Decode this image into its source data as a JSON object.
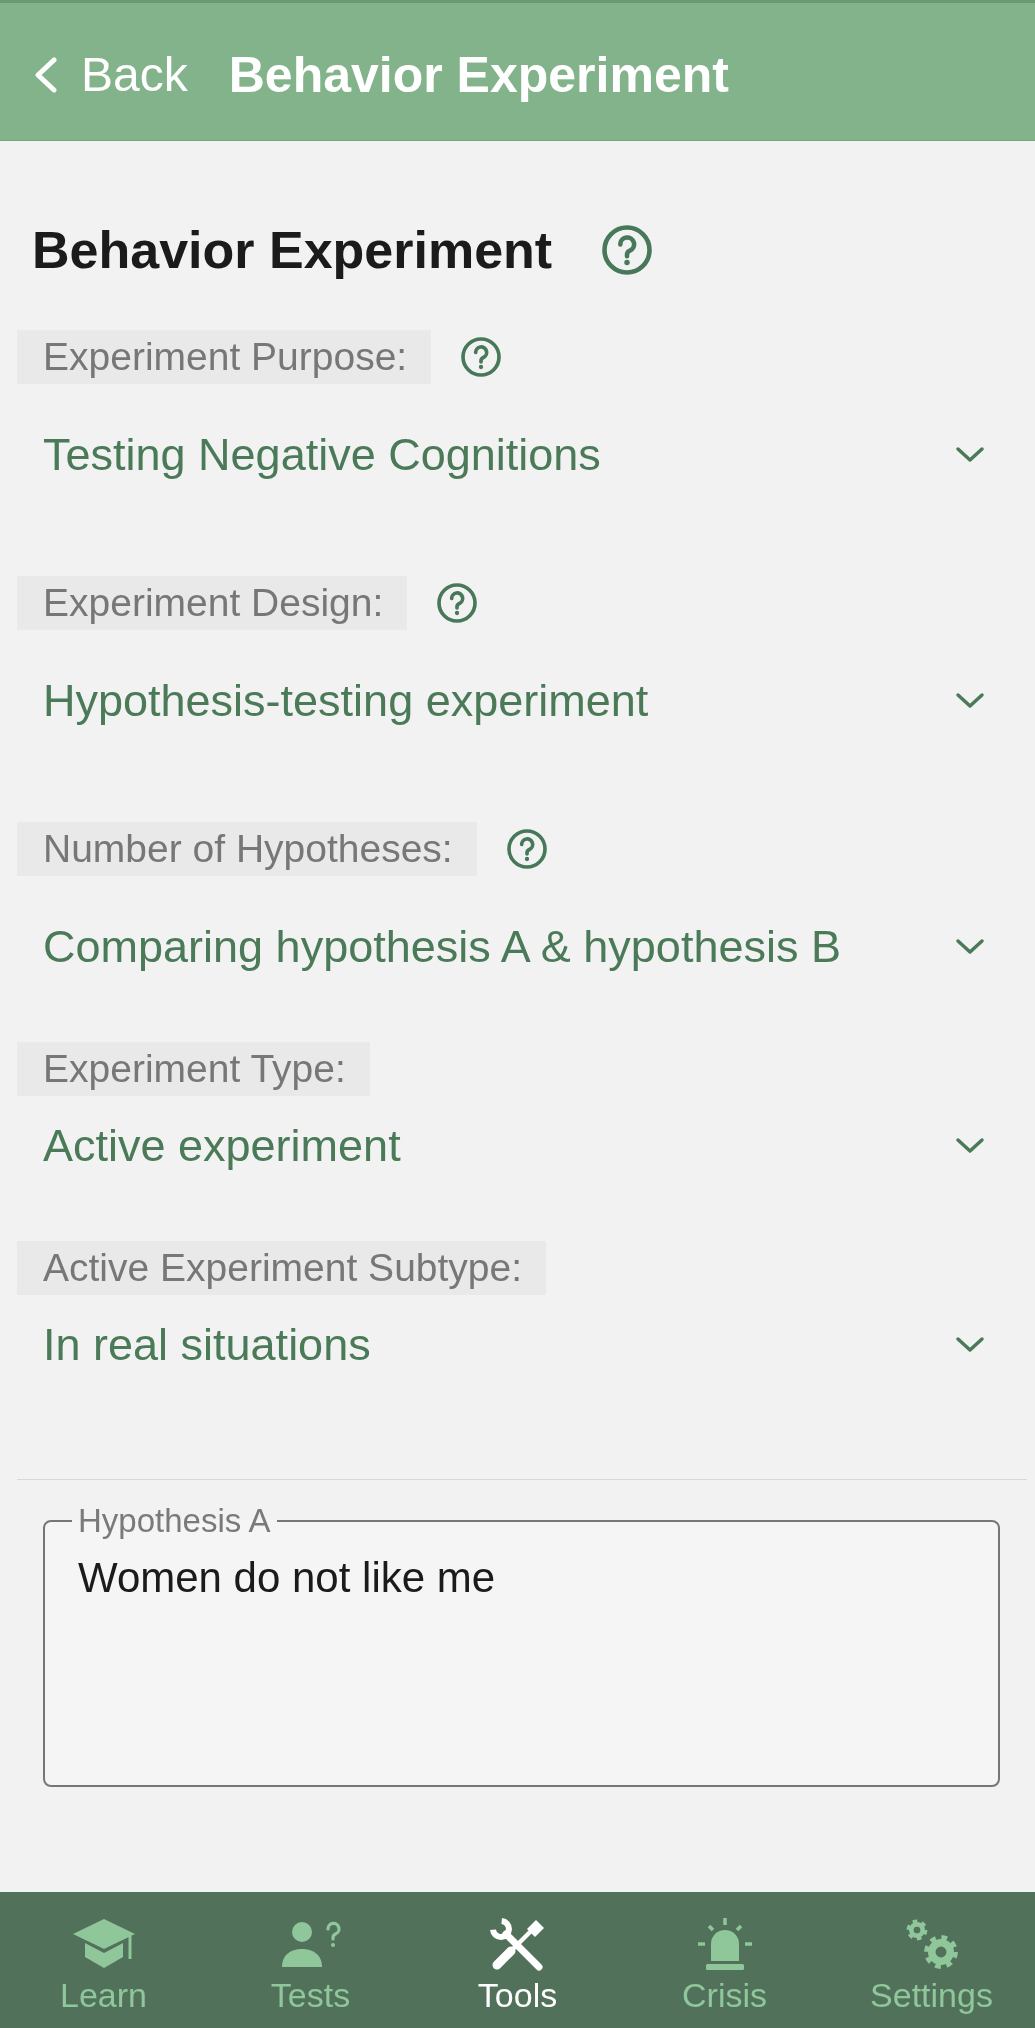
{
  "header": {
    "back_label": "Back",
    "title": "Behavior Experiment"
  },
  "heading": {
    "text": "Behavior Experiment",
    "help": true
  },
  "fields": [
    {
      "label": "Experiment Purpose:",
      "help": true,
      "value": "Testing Negative Cognitions"
    },
    {
      "label": "Experiment Design:",
      "help": true,
      "value": "Hypothesis-testing experiment"
    },
    {
      "label": "Number of Hypotheses:",
      "help": true,
      "value": "Comparing hypothesis A & hypothesis B"
    },
    {
      "label": "Experiment Type:",
      "help": false,
      "value": "Active experiment"
    },
    {
      "label": "Active Experiment Subtype:",
      "help": false,
      "value": "In real situations"
    }
  ],
  "hypothesis_a": {
    "label": "Hypothesis A",
    "value": "Women do not like me"
  },
  "bottom_nav": [
    {
      "label": "Learn",
      "selected": false
    },
    {
      "label": "Tests",
      "selected": false
    },
    {
      "label": "Tools",
      "selected": true
    },
    {
      "label": "Crisis",
      "selected": false
    },
    {
      "label": "Settings",
      "selected": false
    }
  ]
}
